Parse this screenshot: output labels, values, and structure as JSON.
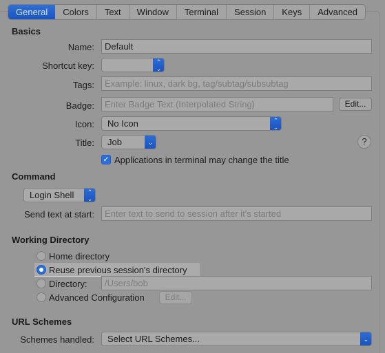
{
  "tabs": [
    {
      "label": "General",
      "active": true
    },
    {
      "label": "Colors",
      "active": false
    },
    {
      "label": "Text",
      "active": false
    },
    {
      "label": "Window",
      "active": false
    },
    {
      "label": "Terminal",
      "active": false
    },
    {
      "label": "Session",
      "active": false
    },
    {
      "label": "Keys",
      "active": false
    },
    {
      "label": "Advanced",
      "active": false
    }
  ],
  "basics": {
    "section_title": "Basics",
    "name_label": "Name:",
    "name_value": "Default",
    "shortcut_label": "Shortcut key:",
    "shortcut_value": "",
    "tags_label": "Tags:",
    "tags_placeholder": "Example: linux, dark bg, tag/subtag/subsubtag",
    "badge_label": "Badge:",
    "badge_placeholder": "Enter Badge Text (Interpolated String)",
    "badge_edit_button": "Edit...",
    "icon_label": "Icon:",
    "icon_value": "No Icon",
    "title_label": "Title:",
    "title_value": "Job",
    "help_button": "?",
    "apps_change_title_label": "Applications in terminal may change the title",
    "apps_change_title_checked": true
  },
  "command": {
    "section_title": "Command",
    "command_type": "Login Shell",
    "send_text_label": "Send text at start:",
    "send_text_placeholder": "Enter text to send to session after it's started"
  },
  "working_directory": {
    "section_title": "Working Directory",
    "options": [
      {
        "label": "Home directory",
        "selected": false
      },
      {
        "label": "Reuse previous session's directory",
        "selected": true
      },
      {
        "label": "Directory:",
        "selected": false
      },
      {
        "label": "Advanced Configuration",
        "selected": false
      }
    ],
    "directory_placeholder": "/Users/bob",
    "advanced_edit_button": "Edit..."
  },
  "url_schemes": {
    "section_title": "URL Schemes",
    "schemes_label": "Schemes handled:",
    "schemes_value": "Select URL Schemes..."
  },
  "colors": {
    "accent": "#1b55c0",
    "background": "#979797"
  }
}
